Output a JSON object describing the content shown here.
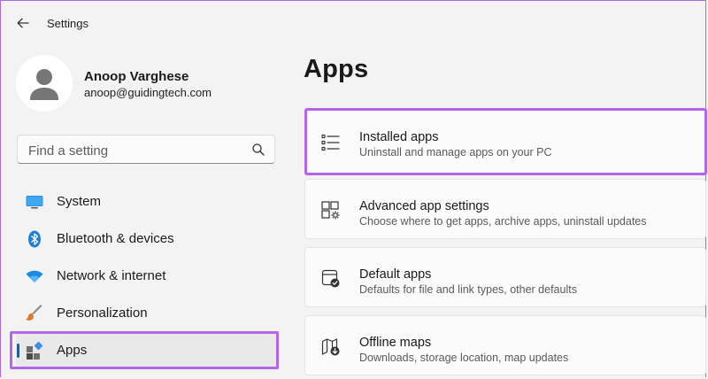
{
  "window": {
    "title": "Settings"
  },
  "profile": {
    "name": "Anoop Varghese",
    "email": "anoop@guidingtech.com"
  },
  "search": {
    "placeholder": "Find a setting"
  },
  "nav": {
    "items": [
      {
        "label": "System",
        "icon": "monitor-icon"
      },
      {
        "label": "Bluetooth & devices",
        "icon": "bluetooth-icon"
      },
      {
        "label": "Network & internet",
        "icon": "wifi-icon"
      },
      {
        "label": "Personalization",
        "icon": "brush-icon"
      },
      {
        "label": "Apps",
        "icon": "apps-icon",
        "active": true
      }
    ]
  },
  "main": {
    "title": "Apps",
    "cards": [
      {
        "title": "Installed apps",
        "subtitle": "Uninstall and manage apps on your PC",
        "icon": "list-icon"
      },
      {
        "title": "Advanced app settings",
        "subtitle": "Choose where to get apps, archive apps, uninstall updates",
        "icon": "app-settings-icon"
      },
      {
        "title": "Default apps",
        "subtitle": "Defaults for file and link types, other defaults",
        "icon": "default-apps-icon"
      },
      {
        "title": "Offline maps",
        "subtitle": "Downloads, storage location, map updates",
        "icon": "map-icon"
      }
    ]
  },
  "colors": {
    "accent": "#0067c0",
    "highlight": "#b565e8"
  }
}
